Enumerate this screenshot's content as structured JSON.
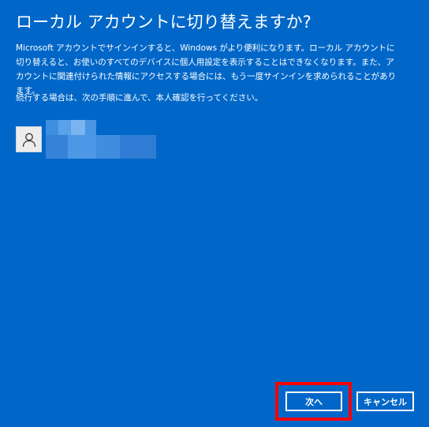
{
  "dialog": {
    "title": "ローカル アカウントに切り替えますか?",
    "description": "Microsoft アカウントでサインインすると、Windows がより便利になります。ローカル アカウントに切り替えると、お使いのすべてのデバイスに個人用設定を表示することはできなくなります。また、アカウントに関連付けられた情報にアクセスする場合には、もう一度サインインを求められることがあります。",
    "continue_note": "続行する場合は、次の手順に進んで、本人確認を行ってください。"
  },
  "account": {
    "avatar_icon": "person-icon"
  },
  "buttons": {
    "next_label": "次へ",
    "cancel_label": "キャンセル"
  },
  "colors": {
    "background": "#0067c8",
    "highlight": "#ff0000"
  }
}
